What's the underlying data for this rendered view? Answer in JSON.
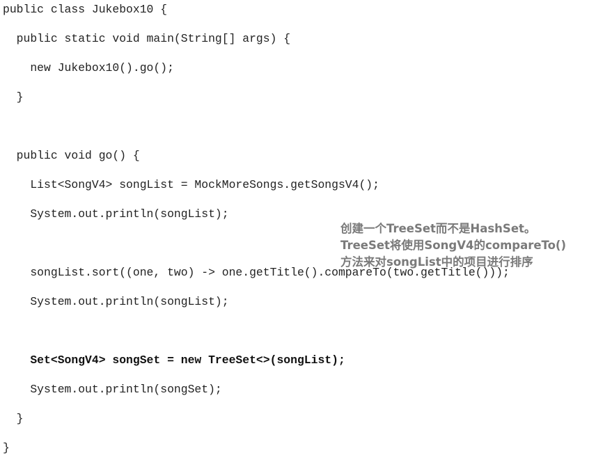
{
  "code": {
    "lines": [
      "public class Jukebox10 {",
      "  public static void main(String[] args) {",
      "    new Jukebox10().go();",
      "  }",
      "",
      "  public void go() {",
      "    List<SongV4> songList = MockMoreSongs.getSongsV4();",
      "    System.out.println(songList);",
      "",
      "    songList.sort((one, two) -> one.getTitle().compareTo(two.getTitle()));",
      "    System.out.println(songList);",
      "",
      "    Set<SongV4> songSet = new TreeSet<>(songList);",
      "    System.out.println(songSet);",
      "  }",
      "}"
    ]
  },
  "annotation": {
    "lines": [
      "创建一个TreeSet而不是HashSet。",
      "TreeSet将使用SongV4的compareTo()",
      "方法来对songList中的项目进行排序"
    ]
  },
  "colors": {
    "code_text": "#222222",
    "annotation_text": "#7a7a7a",
    "background": "#ffffff"
  }
}
